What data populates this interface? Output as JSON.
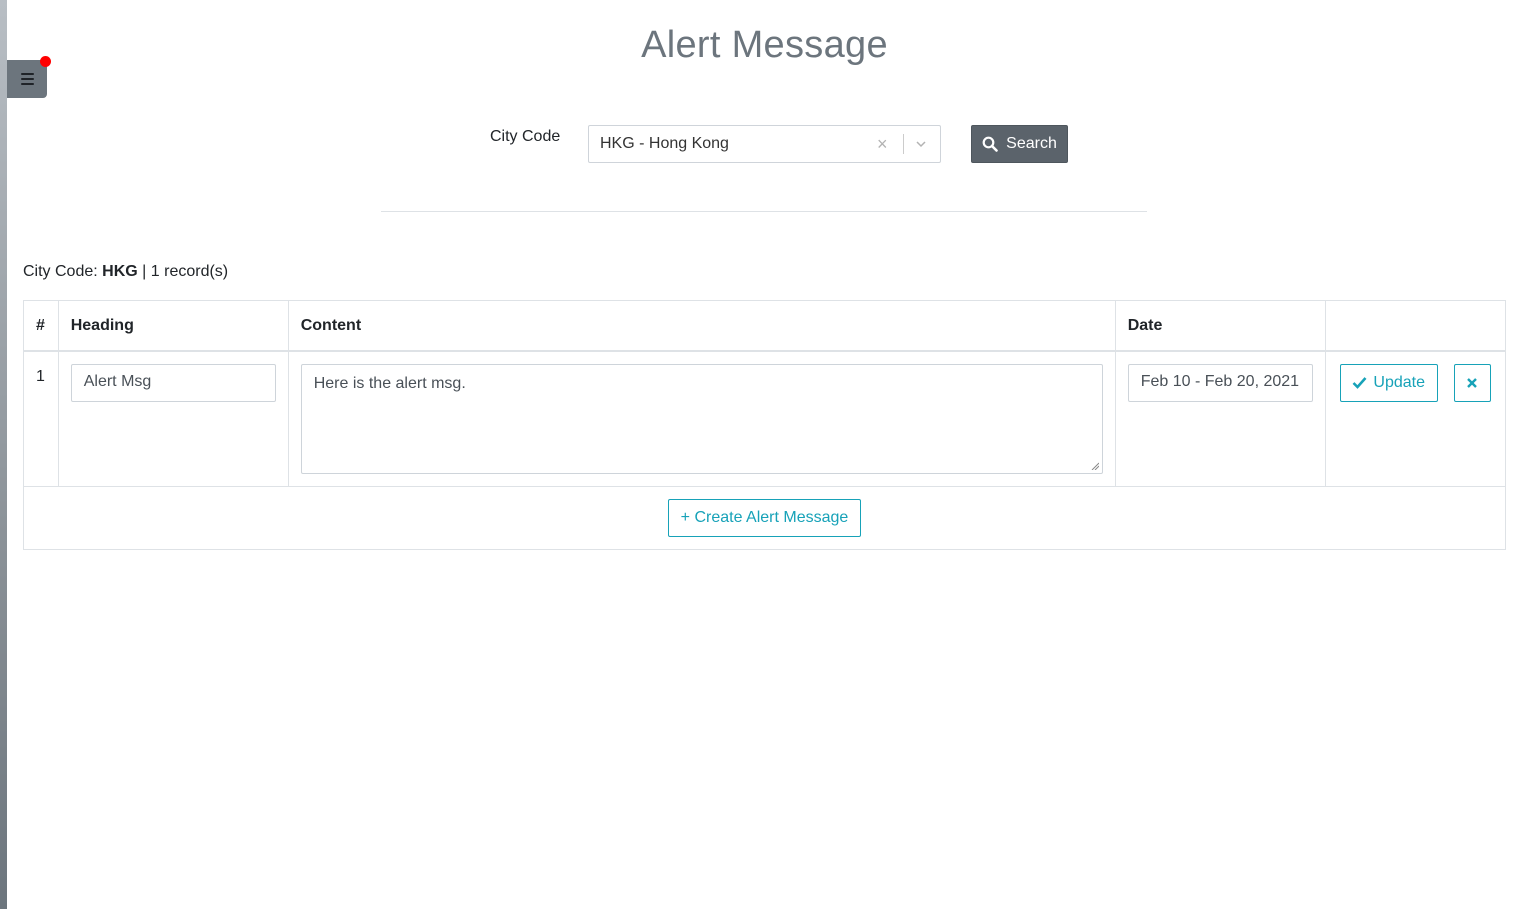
{
  "page": {
    "title": "Alert Message"
  },
  "filter": {
    "label": "City Code",
    "selected": "HKG - Hong Kong",
    "search_label": "Search"
  },
  "summary": {
    "prefix": "City Code:",
    "city": "HKG",
    "separator": "|",
    "count": "1 record(s)"
  },
  "table": {
    "headers": [
      "#",
      "Heading",
      "Content",
      "Date",
      ""
    ],
    "rows": [
      {
        "num": "1",
        "heading": "Alert Msg",
        "content": "Here is the alert msg.",
        "date": "Feb 10 - Feb 20, 2021",
        "update_label": "Update"
      }
    ],
    "create_label": "+ Create Alert Message"
  },
  "colors": {
    "accent": "#17a2b8",
    "muted": "#6c757d",
    "notify": "#ff0000"
  },
  "icons": {
    "menu": "hamburger-icon",
    "search": "search-icon",
    "check": "check-icon",
    "delete": "close-icon",
    "clear": "clear-icon",
    "dropdown": "chevron-down-icon"
  }
}
